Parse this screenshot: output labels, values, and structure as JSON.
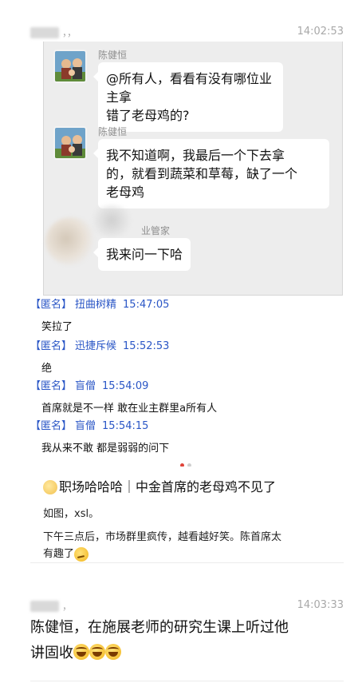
{
  "post1": {
    "author": "，，",
    "time": "14:02:53"
  },
  "screenshot": {
    "messages": [
      {
        "sender": "陈健恒",
        "text_line1": "@所有人，看看有没有哪位业主拿",
        "text_line2": "错了老母鸡的?"
      },
      {
        "sender": "陈健恒",
        "text_line1": "我不知道啊，我最后一个下去拿",
        "text_line2": "的，就看到蔬菜和草莓，缺了一个",
        "text_line3": "老母鸡"
      },
      {
        "sender": "业管家",
        "text_line1": "我来问一下哈"
      }
    ],
    "anon_comments": [
      {
        "tag": "【匿名】",
        "nick": "扭曲树精",
        "time": "15:47:05",
        "text": "笑拉了"
      },
      {
        "tag": "【匿名】",
        "nick": "迅捷斥候",
        "time": "15:52:53",
        "text": "绝"
      },
      {
        "tag": "【匿名】",
        "nick": "盲僧",
        "time": "15:54:09",
        "text": "首席就是不一样 敢在业主群里a所有人"
      },
      {
        "tag": "【匿名】",
        "nick": "盲僧",
        "time": "15:54:15",
        "text": "我从来不敢 都是弱弱的问下"
      }
    ]
  },
  "article": {
    "title": "职场哈哈哈｜中金首席的老母鸡不见了",
    "caption": "如图，xsl。",
    "body_line1": "下午三点后，市场群里疯传，越看越好笑。陈首席太",
    "body_line2": "有趣了",
    "title_icon": "party-emoji-icon",
    "end_icon": "thinking-emoji-icon"
  },
  "post2": {
    "author": "，",
    "time": "14:03:33",
    "line1": "陈健恒，在施展老师的研究生课上听过他",
    "line2": "讲固收",
    "emoji_icon": "laughing-emoji-icon"
  },
  "colors": {
    "anon_blue": "#2a56c6",
    "carousel_active": "#e0443a",
    "chat_bg": "#ededed"
  }
}
